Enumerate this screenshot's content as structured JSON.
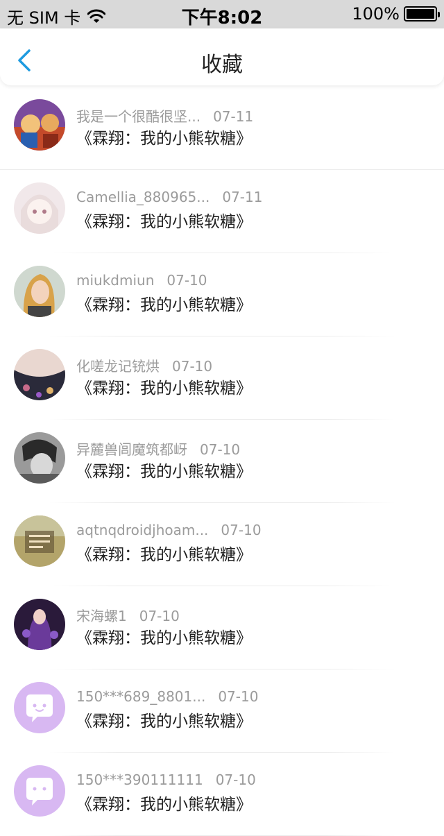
{
  "status_bar": {
    "carrier": "无 SIM 卡",
    "time": "下午8:02",
    "battery": "100%"
  },
  "nav": {
    "title": "收藏"
  },
  "items": [
    {
      "name": "我是一个很酷很坚...",
      "date": "07-11",
      "title": "《霖翔：我的小熊软糖》"
    },
    {
      "name": "Camellia_880965...",
      "date": "07-11",
      "title": "《霖翔：我的小熊软糖》"
    },
    {
      "name": "miukdmiun",
      "date": "07-10",
      "title": "《霖翔：我的小熊软糖》"
    },
    {
      "name": "化嗟龙记铳烘",
      "date": "07-10",
      "title": "《霖翔：我的小熊软糖》"
    },
    {
      "name": "异麓兽闾魔筑都岈",
      "date": "07-10",
      "title": "《霖翔：我的小熊软糖》"
    },
    {
      "name": "aqtnqdroidjhoam...",
      "date": "07-10",
      "title": "《霖翔：我的小熊软糖》"
    },
    {
      "name": "宋海螺1",
      "date": "07-10",
      "title": "《霖翔：我的小熊软糖》"
    },
    {
      "name": "150***689_8801...",
      "date": "07-10",
      "title": "《霖翔：我的小熊软糖》"
    },
    {
      "name": "150***390111111",
      "date": "07-10",
      "title": "《霖翔：我的小熊软糖》"
    }
  ],
  "colors": {
    "back_arrow": "#1e9be0",
    "default_avatar": "#d8b8f2"
  }
}
